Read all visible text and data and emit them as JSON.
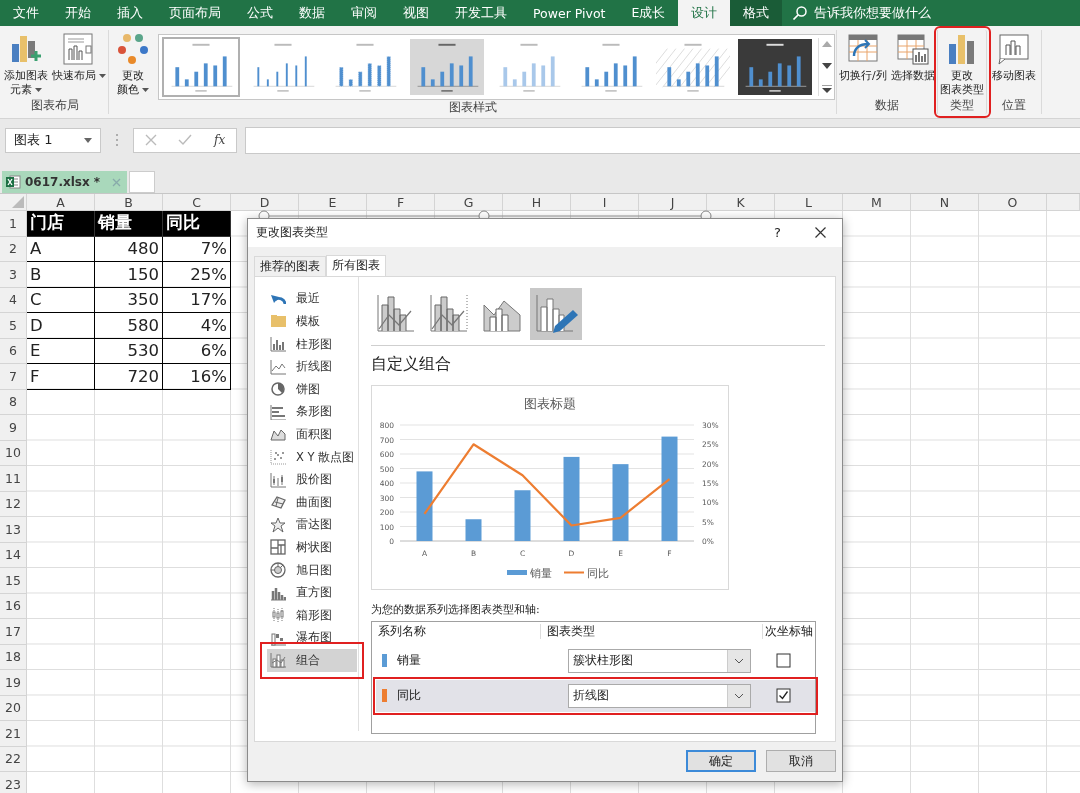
{
  "ribbon": {
    "tabs": [
      {
        "label": "文件",
        "selected": false,
        "contextual": false
      },
      {
        "label": "开始",
        "selected": false,
        "contextual": false
      },
      {
        "label": "插入",
        "selected": false,
        "contextual": false
      },
      {
        "label": "页面布局",
        "selected": false,
        "contextual": false
      },
      {
        "label": "公式",
        "selected": false,
        "contextual": false
      },
      {
        "label": "数据",
        "selected": false,
        "contextual": false
      },
      {
        "label": "审阅",
        "selected": false,
        "contextual": false
      },
      {
        "label": "视图",
        "selected": false,
        "contextual": false
      },
      {
        "label": "开发工具",
        "selected": false,
        "contextual": false
      },
      {
        "label": "Power Pivot",
        "selected": false,
        "contextual": false
      },
      {
        "label": "E成长",
        "selected": false,
        "contextual": false
      },
      {
        "label": "设计",
        "selected": true,
        "contextual": true
      },
      {
        "label": "格式",
        "selected": false,
        "contextual": true
      }
    ],
    "search": {
      "placeholder": "告诉我你想要做什么"
    },
    "groups": [
      {
        "label": "图表布局",
        "highlighted": false,
        "buttons": [
          {
            "lines": [
              "添加图表",
              "元素"
            ],
            "dropdown": true
          },
          {
            "lines": [
              "快速布局"
            ],
            "dropdown": true
          }
        ]
      },
      {
        "label": "图表样式",
        "highlighted": false,
        "buttons": [
          {
            "lines": [
              "更改",
              "颜色"
            ],
            "dropdown": true
          }
        ],
        "gallery": [
          {
            "kind": "plain",
            "selected": true
          },
          {
            "kind": "labeled",
            "selected": false
          },
          {
            "kind": "striped",
            "selected": false
          },
          {
            "kind": "gray",
            "selected": false
          },
          {
            "kind": "light",
            "selected": false
          },
          {
            "kind": "plain",
            "selected": false
          },
          {
            "kind": "hatched",
            "selected": false
          },
          {
            "kind": "dark",
            "selected": false
          }
        ]
      },
      {
        "label": "数据",
        "highlighted": false,
        "buttons": [
          {
            "lines": [
              "切换行/列"
            ],
            "dropdown": false
          },
          {
            "lines": [
              "选择数据"
            ],
            "dropdown": false
          }
        ]
      },
      {
        "label": "类型",
        "highlighted": true,
        "buttons": [
          {
            "lines": [
              "更改",
              "图表类型"
            ],
            "dropdown": false
          }
        ]
      },
      {
        "label": "位置",
        "highlighted": false,
        "buttons": [
          {
            "lines": [
              "移动图表"
            ],
            "dropdown": false
          }
        ]
      }
    ]
  },
  "formula_bar": {
    "name_box": "图表 1",
    "function_label": "fx"
  },
  "workbook_tab": {
    "title": "0617.xlsx *",
    "selected": true
  },
  "sheet": {
    "columns": [
      "A",
      "B",
      "C",
      "D",
      "E",
      "F",
      "G",
      "H",
      "I",
      "J",
      "K",
      "L",
      "M",
      "N",
      "O"
    ],
    "row_numbers": [
      "1",
      "2",
      "3",
      "4",
      "5",
      "6",
      "7",
      "8",
      "9",
      "10",
      "11",
      "12",
      "13",
      "14",
      "15",
      "16",
      "17",
      "18",
      "19",
      "20",
      "21",
      "22",
      "23"
    ],
    "cells": [
      [
        "门店",
        "销量",
        "同比"
      ],
      [
        "A",
        "480",
        "7%"
      ],
      [
        "B",
        "150",
        "25%"
      ],
      [
        "C",
        "350",
        "17%"
      ],
      [
        "D",
        "580",
        "4%"
      ],
      [
        "E",
        "530",
        "6%"
      ],
      [
        "F",
        "720",
        "16%"
      ]
    ],
    "chart_object": {
      "selected": true
    }
  },
  "dialog": {
    "title": "更改图表类型",
    "help": "?",
    "tabs": [
      {
        "label": "推荐的图表",
        "selected": false
      },
      {
        "label": "所有图表",
        "selected": true
      }
    ],
    "categories": [
      {
        "label": "最近",
        "selected": false,
        "highlighted": false
      },
      {
        "label": "模板",
        "selected": false,
        "highlighted": false
      },
      {
        "label": "柱形图",
        "selected": false,
        "highlighted": false
      },
      {
        "label": "折线图",
        "selected": false,
        "highlighted": false
      },
      {
        "label": "饼图",
        "selected": false,
        "highlighted": false
      },
      {
        "label": "条形图",
        "selected": false,
        "highlighted": false
      },
      {
        "label": "面积图",
        "selected": false,
        "highlighted": false
      },
      {
        "label": "X Y 散点图",
        "selected": false,
        "highlighted": false
      },
      {
        "label": "股价图",
        "selected": false,
        "highlighted": false
      },
      {
        "label": "曲面图",
        "selected": false,
        "highlighted": false
      },
      {
        "label": "雷达图",
        "selected": false,
        "highlighted": false
      },
      {
        "label": "树状图",
        "selected": false,
        "highlighted": false
      },
      {
        "label": "旭日图",
        "selected": false,
        "highlighted": false
      },
      {
        "label": "直方图",
        "selected": false,
        "highlighted": false
      },
      {
        "label": "箱形图",
        "selected": false,
        "highlighted": false
      },
      {
        "label": "瀑布图",
        "selected": false,
        "highlighted": false
      },
      {
        "label": "组合",
        "selected": true,
        "highlighted": true
      }
    ],
    "subtypes": [
      {
        "selected": false
      },
      {
        "selected": false
      },
      {
        "selected": false
      },
      {
        "selected": true
      }
    ],
    "heading": "自定义组合",
    "chart_data": {
      "type": "bar",
      "title": "图表标题",
      "categories": [
        "A",
        "B",
        "C",
        "D",
        "E",
        "F"
      ],
      "series": [
        {
          "name": "销量",
          "color": "#5b9bd5",
          "type": "bar",
          "values": [
            480,
            150,
            350,
            580,
            530,
            720
          ]
        },
        {
          "name": "同比",
          "color": "#ed7d31",
          "type": "line",
          "axis": "y2",
          "values": [
            7,
            25,
            17,
            4,
            6,
            16
          ]
        }
      ],
      "grid": true,
      "legend": "bottom",
      "ylim": [
        0,
        800
      ],
      "yticks": [
        0,
        100,
        200,
        300,
        400,
        500,
        600,
        700,
        800
      ],
      "y2lim": [
        0,
        30
      ],
      "y2ticks": [
        {
          "value": 0,
          "label": "0%"
        },
        {
          "value": 5,
          "label": "5%"
        },
        {
          "value": 10,
          "label": "10%"
        },
        {
          "value": 15,
          "label": "15%"
        },
        {
          "value": 20,
          "label": "20%"
        },
        {
          "value": 25,
          "label": "25%"
        },
        {
          "value": 30,
          "label": "30%"
        }
      ]
    },
    "series_prompt": "为您的数据系列选择图表类型和轴:",
    "series_table": {
      "columns": [
        "系列名称",
        "图表类型",
        "次坐标轴"
      ],
      "rows": [
        {
          "name": "销量",
          "color": "#5b9bd5",
          "chart_type": "簇状柱形图",
          "secondary_axis": false,
          "selected": false,
          "highlighted": false
        },
        {
          "name": "同比",
          "color": "#ed7d31",
          "chart_type": "折线图",
          "secondary_axis": true,
          "selected": true,
          "highlighted": true
        }
      ]
    },
    "buttons": [
      {
        "label": "确定",
        "default": true
      },
      {
        "label": "取消",
        "default": false
      }
    ]
  }
}
